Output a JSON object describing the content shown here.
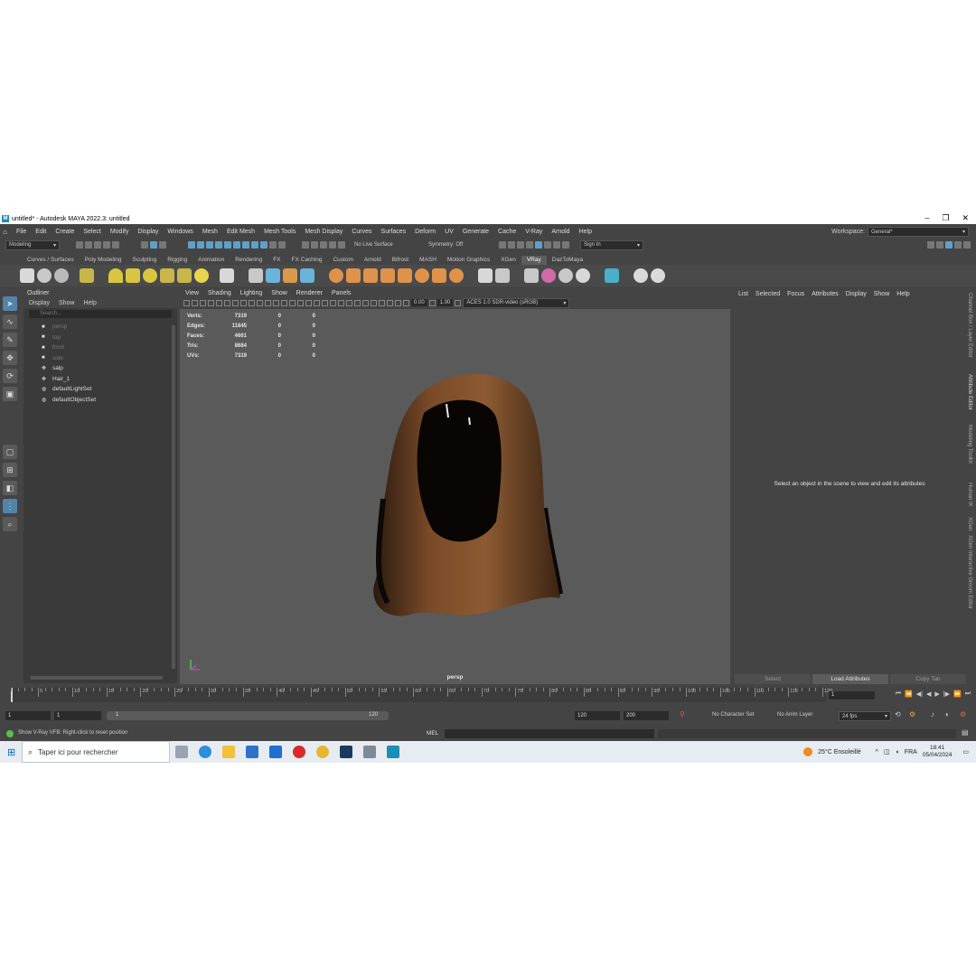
{
  "window": {
    "title": "untitled* - Autodesk MAYA 2022.3: untitled",
    "controls": [
      "–",
      "❐",
      "✕"
    ]
  },
  "menubar": {
    "items": [
      "File",
      "Edit",
      "Create",
      "Select",
      "Modify",
      "Display",
      "Windows",
      "Mesh",
      "Edit Mesh",
      "Mesh Tools",
      "Mesh Display",
      "Curves",
      "Surfaces",
      "Deform",
      "UV",
      "Generate",
      "Cache",
      "V-Ray",
      "Arnold",
      "Help"
    ],
    "workspace_label": "Workspace:",
    "workspace_value": "General*"
  },
  "statusline": {
    "mode": "Modeling",
    "live_surface": "No Live Surface",
    "symmetry": "Symmetry: Off",
    "sign_in": "Sign In"
  },
  "shelf": {
    "tabs": [
      "Curves / Surfaces",
      "Poly Modeling",
      "Sculpting",
      "Rigging",
      "Animation",
      "Rendering",
      "FX",
      "FX Caching",
      "Custom",
      "Arnold",
      "Bifrost",
      "MASH",
      "Motion Graphics",
      "XGen",
      "VRay",
      "DazToMaya"
    ],
    "active_tab": "VRay"
  },
  "outliner": {
    "title": "Outliner",
    "menu": [
      "Display",
      "Show",
      "Help"
    ],
    "search_placeholder": "Search...",
    "items": [
      {
        "label": "persp",
        "dim": true,
        "icon": "camera-icon"
      },
      {
        "label": "top",
        "dim": true,
        "icon": "camera-icon"
      },
      {
        "label": "front",
        "dim": true,
        "icon": "camera-icon"
      },
      {
        "label": "side",
        "dim": true,
        "icon": "camera-icon"
      },
      {
        "label": "salp",
        "dim": false,
        "icon": "transform-icon"
      },
      {
        "label": "Hair_1",
        "dim": false,
        "icon": "transform-icon"
      },
      {
        "label": "defaultLightSet",
        "dim": false,
        "icon": "set-icon"
      },
      {
        "label": "defaultObjectSet",
        "dim": false,
        "icon": "set-icon"
      }
    ]
  },
  "viewport": {
    "menu": [
      "View",
      "Shading",
      "Lighting",
      "Show",
      "Renderer",
      "Panels"
    ],
    "exposure": "0.00",
    "gamma": "1.00",
    "color_space": "ACES 1.0 SDR-video (sRGB)",
    "camera": "persp",
    "hud": [
      {
        "label": "Verts:",
        "value": "7319",
        "a": "0",
        "b": "0"
      },
      {
        "label": "Edges:",
        "value": "11845",
        "a": "0",
        "b": "0"
      },
      {
        "label": "Faces:",
        "value": "4661",
        "a": "0",
        "b": "0"
      },
      {
        "label": "Tris:",
        "value": "8684",
        "a": "0",
        "b": "0"
      },
      {
        "label": "UVs:",
        "value": "7319",
        "a": "0",
        "b": "0"
      }
    ]
  },
  "attribute_editor": {
    "menu": [
      "List",
      "Selected",
      "Focus",
      "Attributes",
      "Display",
      "Show",
      "Help"
    ],
    "message": "Select an object in the scene to view and edit its attributes",
    "buttons": [
      "Select",
      "Load Attributes",
      "Copy Tab"
    ]
  },
  "side_tabs": [
    "Channel Box / Layer Editor",
    "Attribute Editor",
    "Modeling Toolkit",
    "Human IK",
    "XGen",
    "XGen Interactive Groom Editor"
  ],
  "timeslider": {
    "tick_labels": [
      "5",
      "10",
      "15",
      "20",
      "25",
      "30",
      "35",
      "40",
      "45",
      "50",
      "55",
      "60",
      "65",
      "70",
      "75",
      "80",
      "85",
      "90",
      "95",
      "100",
      "105",
      "110",
      "115",
      "120"
    ],
    "current_frame": "1"
  },
  "range": {
    "start": "1",
    "inner_start": "1",
    "slider_start": "1",
    "slider_end": "120",
    "inner_end": "120",
    "end": "200",
    "character_set": "No Character Set",
    "anim_layer": "No Anim Layer",
    "fps": "24 fps"
  },
  "command_line": {
    "help_text": "Show V-Ray VFB: Right-click to reset position",
    "language": "MEL"
  },
  "taskbar": {
    "search_placeholder": "Taper ici pour rechercher",
    "weather": "25°C  Ensoleillé",
    "language": "FRA",
    "time": "18:41",
    "date": "05/04/2024"
  },
  "colors": {
    "accent": "#5284a8",
    "maya_blue": "#2ab1d8"
  }
}
